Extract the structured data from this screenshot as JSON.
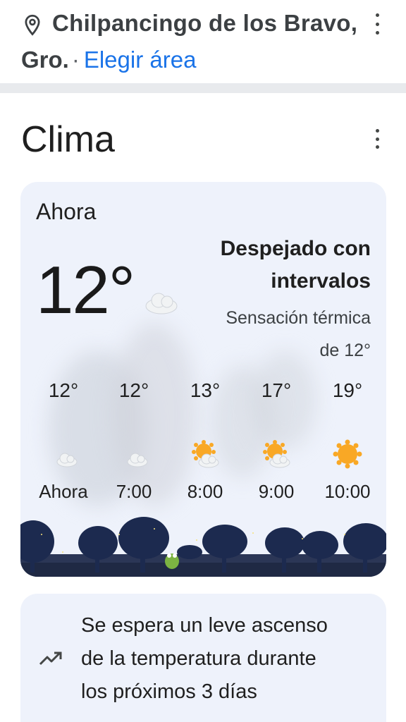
{
  "location": {
    "city": "Chilpancingo de los Bravo,",
    "state": "Gro.",
    "separator": "·",
    "change_area_link": "Elegir área",
    "pin_icon": "location-pin-icon",
    "menu_icon": "more-vert-icon"
  },
  "weather": {
    "title": "Clima",
    "menu_icon": "more-vert-icon",
    "now_label": "Ahora",
    "current_temp": "12°",
    "current_icon": "moon-cloud-icon",
    "condition_line1": "Despejado con",
    "condition_line2": "intervalos",
    "feels_line1": "Sensación térmica",
    "feels_line2": "de 12°",
    "hourly": [
      {
        "temp": "12°",
        "label": "Ahora",
        "icon": "moon-cloud-icon"
      },
      {
        "temp": "12°",
        "label": "7:00",
        "icon": "moon-cloud-icon"
      },
      {
        "temp": "13°",
        "label": "8:00",
        "icon": "sun-cloud-icon"
      },
      {
        "temp": "17°",
        "label": "9:00",
        "icon": "sun-cloud-icon"
      },
      {
        "temp": "19°",
        "label": "10:00",
        "icon": "sun-icon"
      }
    ]
  },
  "trend": {
    "icon": "trending-up-icon",
    "text_line1": "Se espera un leve ascenso",
    "text_line2": "de la temperatura durante",
    "text_line3": "los próximos 3 días"
  },
  "colors": {
    "link": "#1a73e8",
    "card_bg": "#eef2fb",
    "moon": "#4f86f7",
    "sun": "#f9a825",
    "tree": "#1c2a4f"
  }
}
